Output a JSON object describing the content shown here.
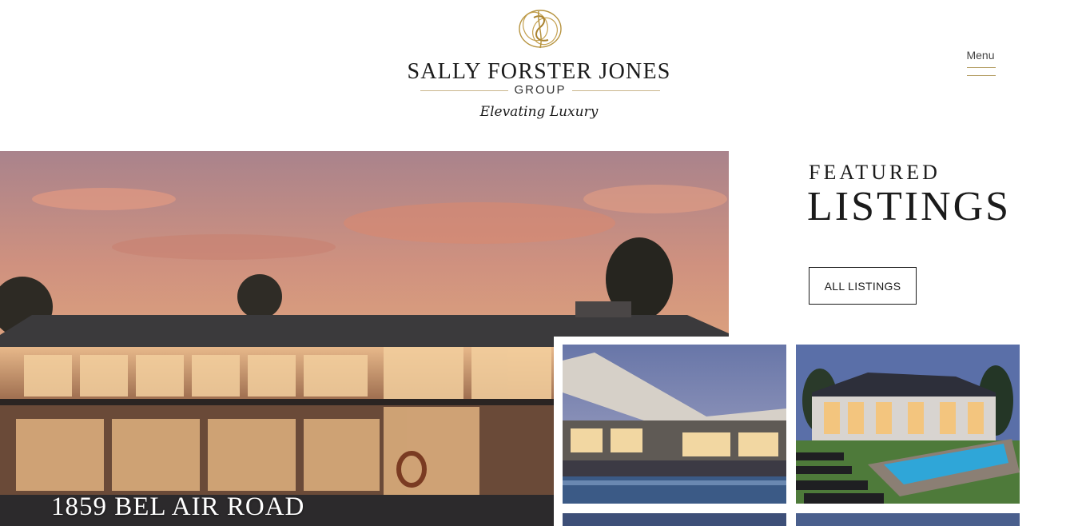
{
  "header": {
    "brand_name": "SALLY FORSTER JONES",
    "brand_group": "GROUP",
    "tagline": "Elevating Luxury",
    "menu_label": "Menu"
  },
  "hero": {
    "caption": "1859 BEL AIR ROAD"
  },
  "featured": {
    "kicker": "FEATURED",
    "title": "LISTINGS",
    "all_listings_label": "ALL LISTINGS"
  },
  "colors": {
    "accent_gold": "#b6a067",
    "text_dark": "#1b1b1b",
    "background": "#ffffff"
  },
  "icons": {
    "logo": "sfj-monogram-logo",
    "menu": "hamburger-menu-icon"
  }
}
